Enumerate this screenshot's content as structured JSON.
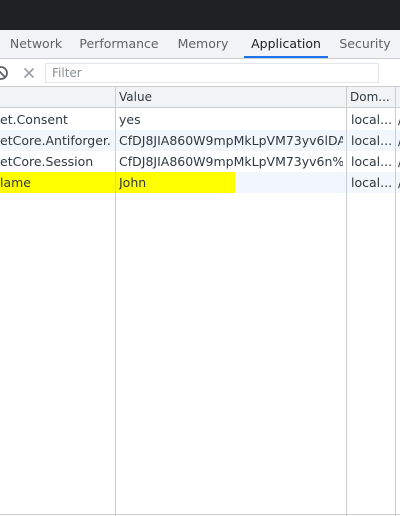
{
  "tabs": [
    {
      "label": "Network"
    },
    {
      "label": "Performance"
    },
    {
      "label": "Memory"
    },
    {
      "label": "Application",
      "active": true
    },
    {
      "label": "Security"
    }
  ],
  "toolbar": {
    "filter_placeholder": "Filter",
    "clear_icon": "block-icon",
    "delete_icon": "close-icon"
  },
  "table": {
    "columns": [
      "",
      "Value",
      "Dom...",
      ""
    ],
    "rows": [
      {
        "name": "et.Consent",
        "value": "yes",
        "domain": "local...",
        "path": "/"
      },
      {
        "name": "etCore.Antiforger...",
        "value": "CfDJ8JIA860W9mpMkLpVM73yv6lDA...",
        "domain": "local...",
        "path": "/"
      },
      {
        "name": "etCore.Session",
        "value": "CfDJ8JIA860W9mpMkLpVM73yv6n%...",
        "domain": "local...",
        "path": "/"
      },
      {
        "name": "lame",
        "value": "John",
        "domain": "local...",
        "path": "/",
        "highlighted": true
      }
    ]
  },
  "colors": {
    "titlebar": "#202124",
    "tab_active_underline": "#1a73e8",
    "highlight": "#ffff00",
    "row_alt": "#f2f7fd"
  }
}
